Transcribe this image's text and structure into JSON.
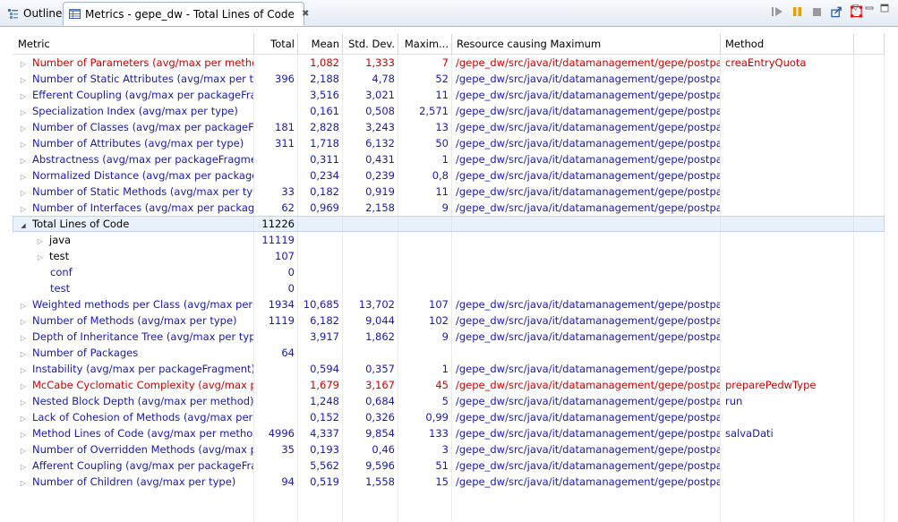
{
  "tabs": {
    "outline": "Outline",
    "metrics": "Metrics - gepe_dw - Total Lines of Code",
    "close_symbol": "✖"
  },
  "colors": {
    "normal": "#1a1ab0",
    "violation": "#d10000",
    "selected_bg": "#e9f1fb"
  },
  "columns": {
    "metric": "Metric",
    "total": "Total",
    "mean": "Mean",
    "std": "Std. Dev.",
    "max": "Maxim...",
    "resource": "Resource causing Maximum",
    "method": "Method"
  },
  "rows": [
    {
      "metric": "Number of Parameters (avg/max per method)",
      "total": "",
      "mean": "1,082",
      "std": "1,333",
      "max": "7",
      "resource": "/gepe_dw/src/java/it/datamanagement/gepe/postpa...",
      "method": "creaEntryQuota",
      "red": true
    },
    {
      "metric": "Number of Static Attributes (avg/max per type",
      "total": "396",
      "mean": "2,188",
      "std": "4,78",
      "max": "52",
      "resource": "/gepe_dw/src/java/it/datamanagement/gepe/postpa...",
      "method": ""
    },
    {
      "metric": "Efferent Coupling (avg/max per packageFragm",
      "total": "",
      "mean": "3,516",
      "std": "3,021",
      "max": "11",
      "resource": "/gepe_dw/src/java/it/datamanagement/gepe/postpa...",
      "method": ""
    },
    {
      "metric": "Specialization Index (avg/max per type)",
      "total": "",
      "mean": "0,161",
      "std": "0,508",
      "max": "2,571",
      "resource": "/gepe_dw/src/java/it/datamanagement/gepe/postpa...",
      "method": ""
    },
    {
      "metric": "Number of Classes (avg/max per packageFragr",
      "total": "181",
      "mean": "2,828",
      "std": "3,243",
      "max": "13",
      "resource": "/gepe_dw/src/java/it/datamanagement/gepe/postpa...",
      "method": ""
    },
    {
      "metric": "Number of Attributes (avg/max per type)",
      "total": "311",
      "mean": "1,718",
      "std": "6,132",
      "max": "50",
      "resource": "/gepe_dw/src/java/it/datamanagement/gepe/postpa...",
      "method": ""
    },
    {
      "metric": "Abstractness (avg/max per packageFragment)",
      "total": "",
      "mean": "0,311",
      "std": "0,431",
      "max": "1",
      "resource": "/gepe_dw/src/java/it/datamanagement/gepe/postpa...",
      "method": ""
    },
    {
      "metric": "Normalized Distance (avg/max per packageFra",
      "total": "",
      "mean": "0,234",
      "std": "0,239",
      "max": "0,8",
      "resource": "/gepe_dw/src/java/it/datamanagement/gepe/postpa...",
      "method": ""
    },
    {
      "metric": "Number of Static Methods (avg/max per type)",
      "total": "33",
      "mean": "0,182",
      "std": "0,919",
      "max": "11",
      "resource": "/gepe_dw/src/java/it/datamanagement/gepe/postpa...",
      "method": ""
    },
    {
      "metric": "Number of Interfaces (avg/max per packageFra",
      "total": "62",
      "mean": "0,969",
      "std": "2,158",
      "max": "9",
      "resource": "/gepe_dw/src/java/it/datamanagement/gepe/postpa...",
      "method": ""
    },
    {
      "metric": "Total Lines of Code",
      "total": "11226",
      "mean": "",
      "std": "",
      "max": "",
      "resource": "",
      "method": "",
      "selected": true,
      "expanded": true
    },
    {
      "metric": "java",
      "total": "11119",
      "mean": "",
      "std": "",
      "max": "",
      "resource": "",
      "method": "",
      "child": true,
      "expandable": true
    },
    {
      "metric": "test",
      "total": "107",
      "mean": "",
      "std": "",
      "max": "",
      "resource": "",
      "method": "",
      "child": true,
      "expandable": true
    },
    {
      "metric": "conf",
      "total": "0",
      "mean": "",
      "std": "",
      "max": "",
      "resource": "",
      "method": "",
      "child": true,
      "leaf": true
    },
    {
      "metric": "test",
      "total": "0",
      "mean": "",
      "std": "",
      "max": "",
      "resource": "",
      "method": "",
      "child": true,
      "leaf": true
    },
    {
      "metric": "Weighted methods per Class (avg/max per typ",
      "total": "1934",
      "mean": "10,685",
      "std": "13,702",
      "max": "107",
      "resource": "/gepe_dw/src/java/it/datamanagement/gepe/postpa...",
      "method": ""
    },
    {
      "metric": "Number of Methods (avg/max per type)",
      "total": "1119",
      "mean": "6,182",
      "std": "9,044",
      "max": "102",
      "resource": "/gepe_dw/src/java/it/datamanagement/gepe/postpa...",
      "method": ""
    },
    {
      "metric": "Depth of Inheritance Tree (avg/max per type)",
      "total": "",
      "mean": "3,917",
      "std": "1,862",
      "max": "9",
      "resource": "/gepe_dw/src/java/it/datamanagement/gepe/postpa...",
      "method": ""
    },
    {
      "metric": "Number of Packages",
      "total": "64",
      "mean": "",
      "std": "",
      "max": "",
      "resource": "",
      "method": ""
    },
    {
      "metric": "Instability (avg/max per packageFragment)",
      "total": "",
      "mean": "0,594",
      "std": "0,357",
      "max": "1",
      "resource": "/gepe_dw/src/java/it/datamanagement/gepe/postpa...",
      "method": ""
    },
    {
      "metric": "McCabe Cyclomatic Complexity (avg/max per",
      "total": "",
      "mean": "1,679",
      "std": "3,167",
      "max": "45",
      "resource": "/gepe_dw/src/java/it/datamanagement/gepe/postpa...",
      "method": "preparePedwType",
      "red": true
    },
    {
      "metric": "Nested Block Depth (avg/max per method)",
      "total": "",
      "mean": "1,248",
      "std": "0,684",
      "max": "5",
      "resource": "/gepe_dw/src/java/it/datamanagement/gepe/postpa...",
      "method": "run"
    },
    {
      "metric": "Lack of Cohesion of Methods (avg/max per typ",
      "total": "",
      "mean": "0,152",
      "std": "0,326",
      "max": "0,99",
      "resource": "/gepe_dw/src/java/it/datamanagement/gepe/postpa...",
      "method": ""
    },
    {
      "metric": "Method Lines of Code (avg/max per method)",
      "total": "4996",
      "mean": "4,337",
      "std": "9,854",
      "max": "133",
      "resource": "/gepe_dw/src/java/it/datamanagement/gepe/postpa...",
      "method": "salvaDati"
    },
    {
      "metric": "Number of Overridden Methods (avg/max per",
      "total": "35",
      "mean": "0,193",
      "std": "0,46",
      "max": "3",
      "resource": "/gepe_dw/src/java/it/datamanagement/gepe/postpa...",
      "method": ""
    },
    {
      "metric": "Afferent Coupling (avg/max per packageFragm",
      "total": "",
      "mean": "5,562",
      "std": "9,596",
      "max": "51",
      "resource": "/gepe_dw/src/java/it/datamanagement/gepe/postpa...",
      "method": ""
    },
    {
      "metric": "Number of Children (avg/max per type)",
      "total": "94",
      "mean": "0,519",
      "std": "1,558",
      "max": "15",
      "resource": "/gepe_dw/src/java/it/datamanagement/gepe/postpa...",
      "method": ""
    }
  ],
  "empty_rows": 2
}
